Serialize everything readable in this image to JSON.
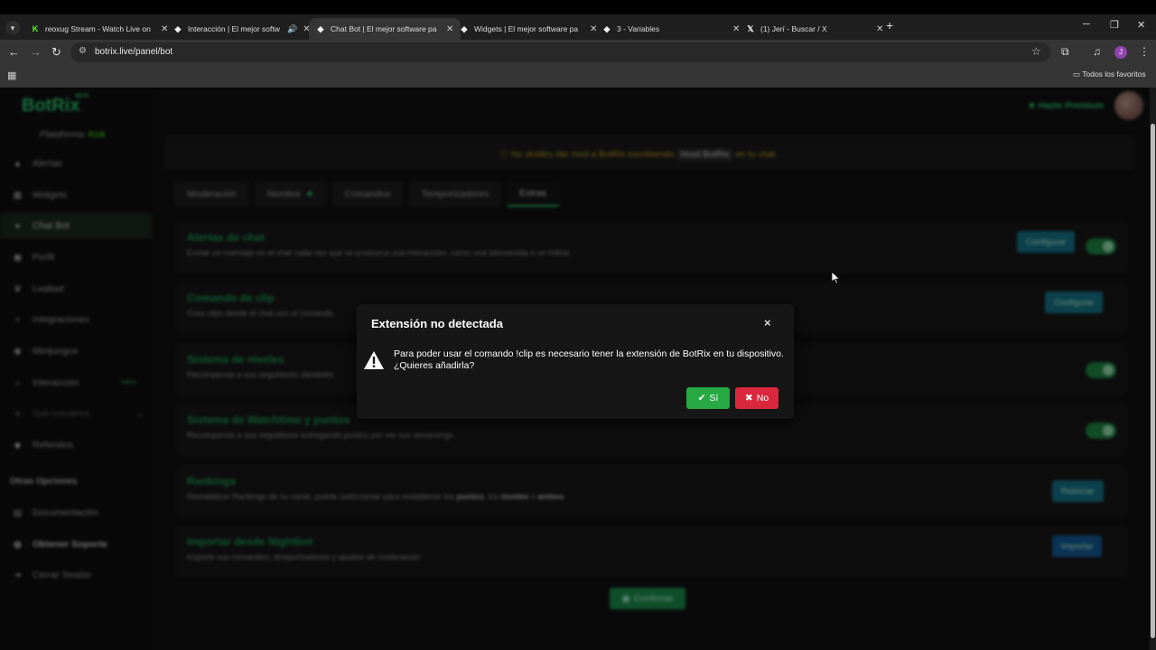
{
  "browser": {
    "tabs": [
      {
        "title": "reoxug Stream - Watch Live on",
        "icon": "kick-icon"
      },
      {
        "title": "Interacción | El mejor softw",
        "icon": "botrix-icon",
        "audio": "🔊"
      },
      {
        "title": "Chat Bot | El mejor software pa",
        "icon": "botrix-icon",
        "active": true
      },
      {
        "title": "Widgets | El mejor software pa",
        "icon": "botrix-icon"
      },
      {
        "title": "3 - Variables",
        "icon": "botrix-icon"
      },
      {
        "title": "(1) Jerí - Buscar / X",
        "icon": "x-icon"
      }
    ],
    "url": "botrix.live/panel/bot",
    "profile_initial": "J",
    "bookmarks_all": "Todos los favoritos"
  },
  "sidebar": {
    "logo": "BotRix",
    "beta": "BETA",
    "platform_label": "Plataforma:",
    "platform_value": "Kick",
    "items": [
      {
        "label": "Alertas",
        "icon": "alert-icon"
      },
      {
        "label": "Widgets",
        "icon": "widgets-icon"
      },
      {
        "label": "Chat Bot",
        "icon": "chat-icon",
        "active": true
      },
      {
        "label": "Perfil",
        "icon": "profile-icon"
      },
      {
        "label": "Lealtad",
        "icon": "trophy-icon"
      },
      {
        "label": "Integraciones",
        "icon": "integrations-icon"
      },
      {
        "label": "Minijuegos",
        "icon": "gamepad-icon"
      },
      {
        "label": "Interacción",
        "icon": "music-icon",
        "badge": "nuevo"
      },
      {
        "label": "Sub-Usuarios",
        "icon": "users-icon"
      },
      {
        "label": "Referidos",
        "icon": "referrals-icon"
      }
    ],
    "section_title": "Otras Opciones",
    "other_items": [
      {
        "label": "Documentación",
        "icon": "docs-icon"
      },
      {
        "label": "Obtener Soporte",
        "icon": "support-icon"
      },
      {
        "label": "Cerrar Sesión",
        "icon": "logout-icon"
      }
    ]
  },
  "header": {
    "premium_label": "Hazte Premium"
  },
  "notice": {
    "text_before": "No olvides dar mod a BotRix escribiendo",
    "command": "/mod BotRix",
    "text_after": "en tu chat."
  },
  "tabs": [
    {
      "label": "Moderación"
    },
    {
      "label": "Nombre",
      "star": true
    },
    {
      "label": "Comandos"
    },
    {
      "label": "Temporizadores"
    },
    {
      "label": "Extras",
      "active": true
    }
  ],
  "cards": [
    {
      "title": "Alertas de chat",
      "desc": "Enviar un mensaje en el chat cada vez que se produzca una interacción, como una bienvenida o un follow.",
      "button": "Configurar",
      "toggle": true
    },
    {
      "title": "Comando de clip",
      "desc": "Crea clips desde el chat con el comando",
      "button": "Configurar"
    },
    {
      "title": "Sistema de niveles",
      "desc": "Recompense a sus seguidores dándoles",
      "toggle": true
    },
    {
      "title": "Sistema de  Watchtime  y puntos",
      "desc": "Recompense a sus seguidores entregando puntos por ver sus streamings.",
      "toggle": true
    },
    {
      "title": "Rankings",
      "desc_before": "Restablecer Rankings de su canal, puede seleccionar para restablecer los ",
      "desc_b1": "puntos",
      "desc_mid1": ", los ",
      "desc_b2": "niveles",
      "desc_mid2": " o ",
      "desc_b3": "ambos",
      "desc_after": ".",
      "button": "Reiniciar"
    },
    {
      "title": "Importar desde Nightbot",
      "desc": "Importe sus comandos, temporizadores y ajustes de moderación",
      "button": "Importar"
    }
  ],
  "confirm_label": "Confirmar",
  "modal": {
    "title": "Extensión no detectada",
    "close": "×",
    "message_line1": "Para poder usar el comando !clip es necesario tener la extensión de BotRix en tu dispositivo.",
    "message_line2": "¿Quieres añadirla?",
    "yes_label": "Sí",
    "no_label": "No"
  },
  "colors": {
    "accent_green": "#2ecc71",
    "yes_button": "#27a944",
    "no_button": "#d9283d",
    "warning_notice": "#c9a227"
  }
}
